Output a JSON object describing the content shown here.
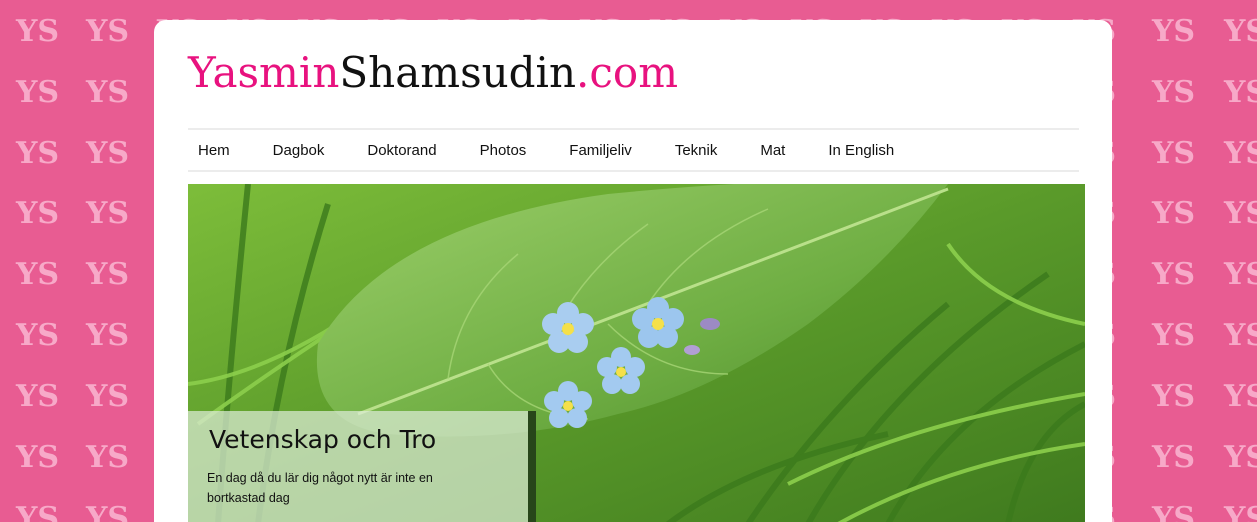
{
  "site": {
    "logo_part1": "Yasmin",
    "logo_part2": "Shamsudin",
    "logo_part3": ".com"
  },
  "background_pattern_text": "YS",
  "nav": {
    "items": [
      {
        "label": "Hem"
      },
      {
        "label": "Dagbok"
      },
      {
        "label": "Doktorand"
      },
      {
        "label": "Photos"
      },
      {
        "label": "Familjeliv"
      },
      {
        "label": "Teknik"
      },
      {
        "label": "Mat"
      },
      {
        "label": "In English"
      }
    ]
  },
  "hero": {
    "title": "Vetenskap och Tro",
    "text": "En dag då du lär dig något nytt är inte en bortkastad dag"
  },
  "colors": {
    "background": "#e85c92",
    "pattern": "#f7a9c8",
    "logo_pink": "#e8127f",
    "panel": "#ffffff"
  }
}
